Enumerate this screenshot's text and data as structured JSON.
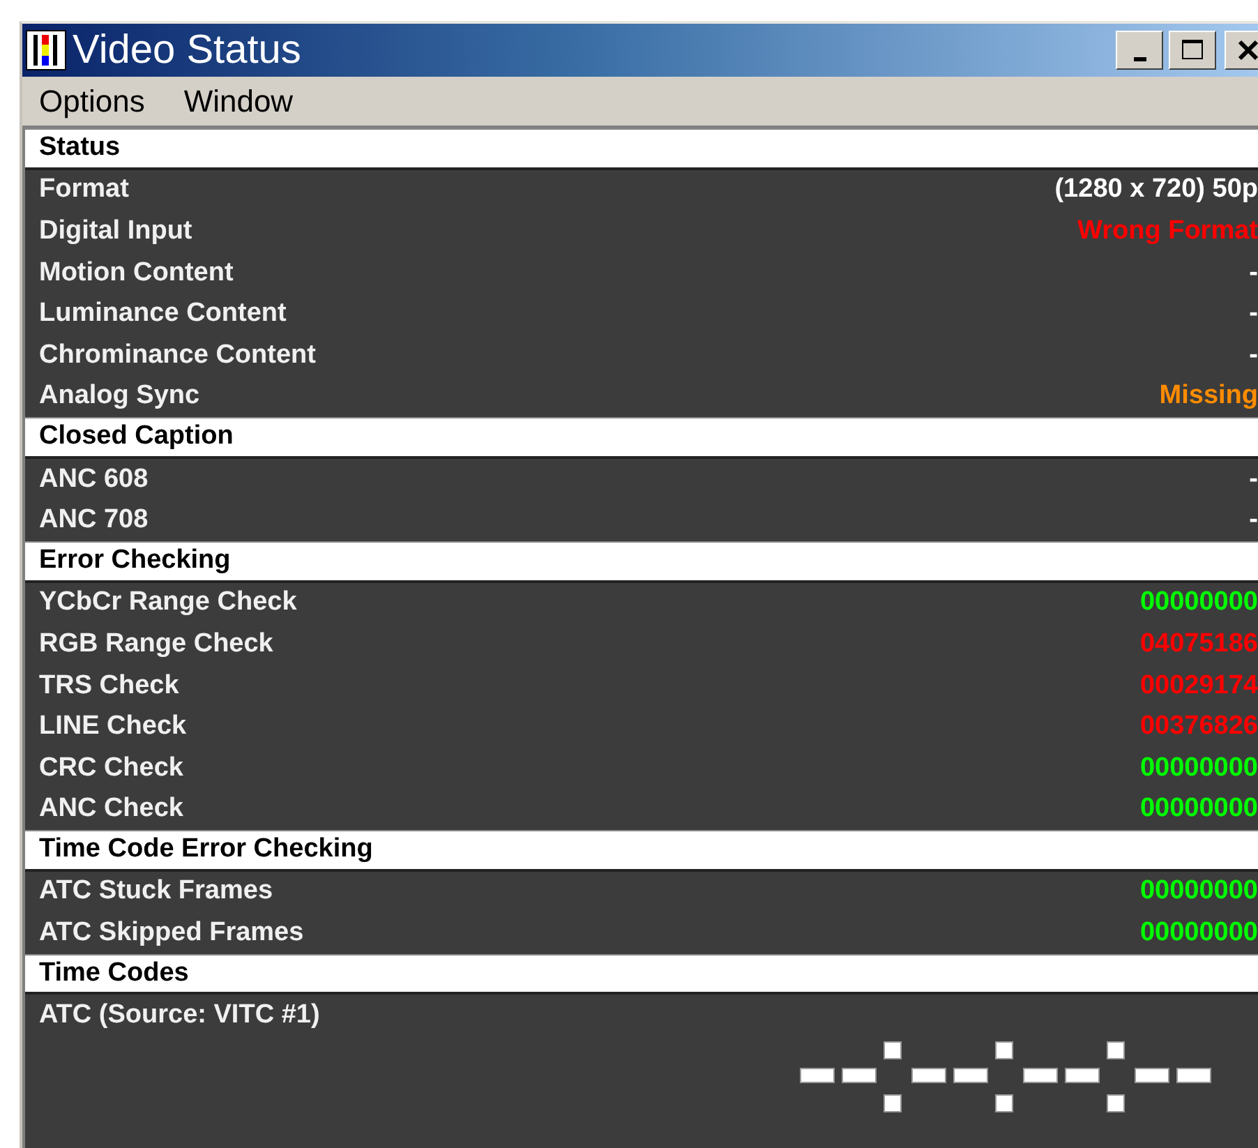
{
  "window": {
    "title": "Video Status"
  },
  "menu": [
    "Options",
    "Window"
  ],
  "sections": [
    {
      "title": "Status",
      "rows": [
        {
          "kind": "reading",
          "label": "Format",
          "value": "(1280 x 720) 50p",
          "color": "#ffffff"
        },
        {
          "kind": "reading",
          "label": "Digital Input",
          "value": "Wrong Format",
          "color": "#ff0000"
        },
        {
          "kind": "reading",
          "label": "Motion Content",
          "value": "-",
          "color": "#ffffff"
        },
        {
          "kind": "reading",
          "label": "Luminance Content",
          "value": "-",
          "color": "#ffffff"
        },
        {
          "kind": "reading",
          "label": "Chrominance Content",
          "value": "-",
          "color": "#ffffff"
        },
        {
          "kind": "reading",
          "label": "Analog Sync",
          "value": "Missing",
          "color": "#ff8c00"
        }
      ]
    },
    {
      "title": "Closed Caption",
      "rows": [
        {
          "kind": "reading",
          "label": "ANC 608",
          "value": "-",
          "color": "#ffffff"
        },
        {
          "kind": "reading",
          "label": "ANC 708",
          "value": "-",
          "color": "#ffffff"
        }
      ]
    },
    {
      "title": "Error Checking",
      "rows": [
        {
          "kind": "reading",
          "label": "YCbCr Range Check",
          "value": "00000000",
          "color": "#00ff00"
        },
        {
          "kind": "reading",
          "label": "RGB Range Check",
          "value": "04075186",
          "color": "#ff0000"
        },
        {
          "kind": "reading",
          "label": "TRS Check",
          "value": "00029174",
          "color": "#ff0000"
        },
        {
          "kind": "reading",
          "label": "LINE Check",
          "value": "00376826",
          "color": "#ff0000"
        },
        {
          "kind": "reading",
          "label": "CRC Check",
          "value": "00000000",
          "color": "#00ff00"
        },
        {
          "kind": "reading",
          "label": "ANC Check",
          "value": "00000000",
          "color": "#00ff00"
        }
      ]
    },
    {
      "title": "Time Code Error Checking",
      "rows": [
        {
          "kind": "reading",
          "label": "ATC Stuck Frames",
          "value": "00000000",
          "color": "#00ff00"
        },
        {
          "kind": "reading",
          "label": "ATC Skipped Frames",
          "value": "00000000",
          "color": "#00ff00"
        }
      ]
    },
    {
      "title": "Time Codes",
      "rows": [
        {
          "kind": "timecode",
          "label": "ATC (Source: VITC #1)"
        }
      ]
    }
  ]
}
